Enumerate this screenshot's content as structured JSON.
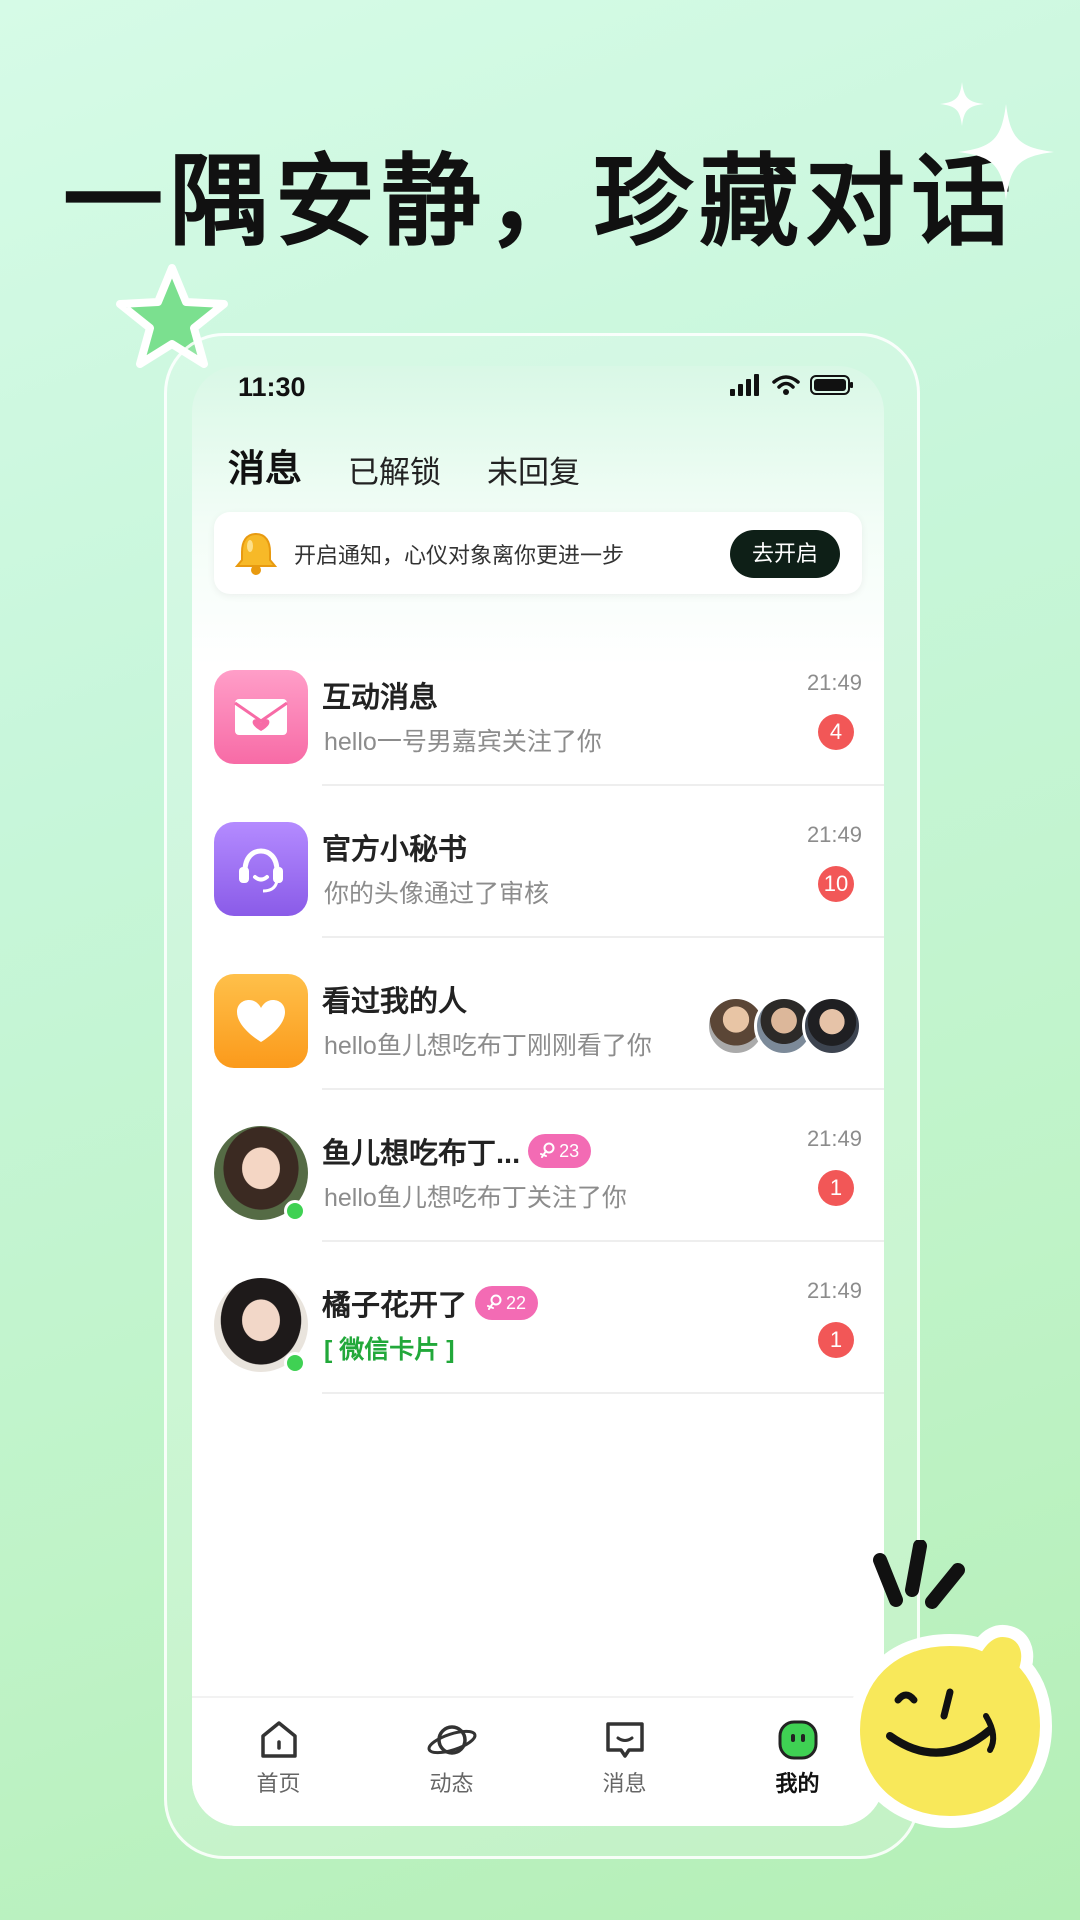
{
  "headline": "一隅安静，珍藏对话",
  "status_bar": {
    "time": "11:30"
  },
  "tabs": [
    {
      "label": "消息",
      "active": true
    },
    {
      "label": "已解锁",
      "active": false
    },
    {
      "label": "未回复",
      "active": false
    }
  ],
  "notice": {
    "text": "开启通知，心仪对象离你更进一步",
    "button": "去开启",
    "icon": "bell-icon"
  },
  "conversations": [
    {
      "name": "互动消息",
      "preview": "hello一号男嘉宾关注了你",
      "time": "21:49",
      "badge": "4",
      "icon": "envelope-heart-icon",
      "icon_color": "#f77fb1"
    },
    {
      "name": "官方小秘书",
      "preview": "你的头像通过了审核",
      "time": "21:49",
      "badge": "10",
      "icon": "headset-icon",
      "icon_color": "#9d6bf0"
    },
    {
      "name": "看过我的人",
      "preview": "hello鱼儿想吃布丁刚刚看了你",
      "icon": "heart-icon",
      "icon_color": "#fca726"
    },
    {
      "name": "鱼儿想吃布丁...",
      "tag": "23",
      "preview": "hello鱼儿想吃布丁关注了你",
      "time": "21:49",
      "badge": "1",
      "online": true
    },
    {
      "name": "橘子花开了",
      "tag": "22",
      "preview": "[ 微信卡片 ]",
      "time": "21:49",
      "badge": "1",
      "online": true
    }
  ],
  "bottom_nav": [
    {
      "label": "首页",
      "icon": "home-icon",
      "active": false
    },
    {
      "label": "动态",
      "icon": "planet-icon",
      "active": false
    },
    {
      "label": "消息",
      "icon": "message-icon",
      "active": false
    },
    {
      "label": "我的",
      "icon": "profile-face-icon",
      "active": true
    }
  ],
  "colors": {
    "accent_green": "#3fd153",
    "badge_red": "#f25757",
    "tag_pink": "#f36bb4",
    "dark_button": "#0e1f17"
  }
}
